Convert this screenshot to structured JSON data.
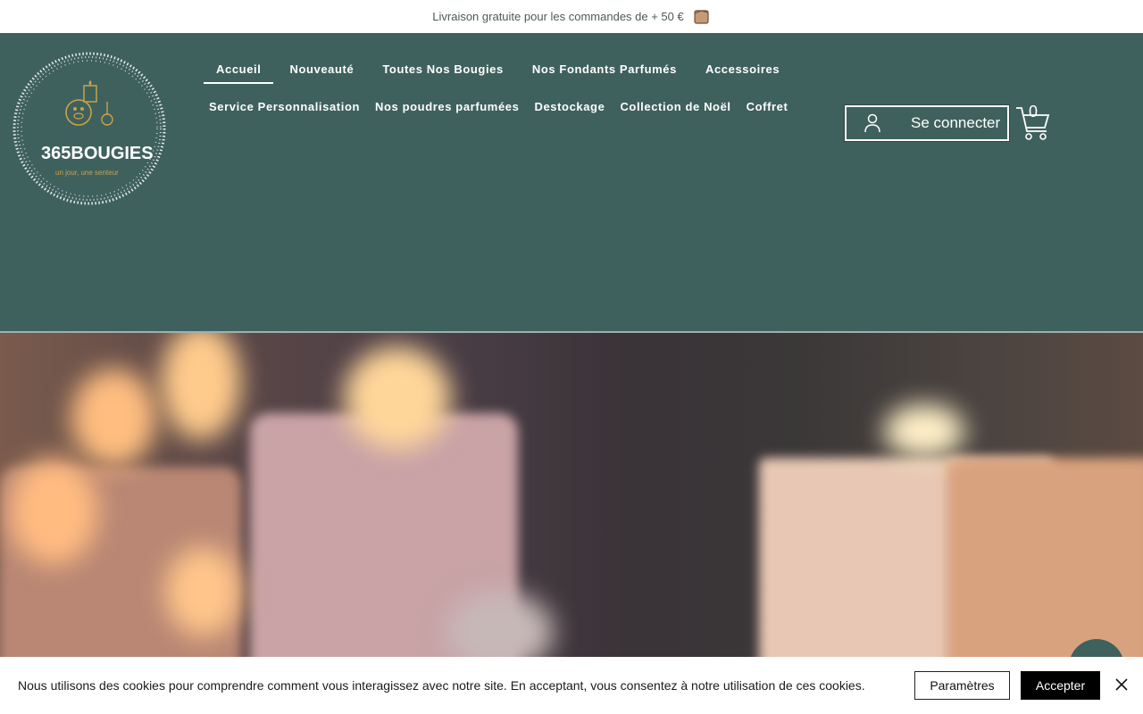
{
  "announcement": {
    "text": "Livraison gratuite pour les commandes de + 50 €",
    "icon": "package-box-icon"
  },
  "logo": {
    "brand": "365BOUGIES",
    "tagline": "un jour, une senteur"
  },
  "nav": {
    "row1": [
      {
        "label": "Accueil",
        "active": true
      },
      {
        "label": "Nouveauté"
      },
      {
        "label": "Toutes Nos Bougies"
      },
      {
        "label": "Nos Fondants Parfumés"
      },
      {
        "label": "Accessoires"
      }
    ],
    "row2": [
      {
        "label": "Service Personnalisation"
      },
      {
        "label": "Nos poudres parfumées"
      },
      {
        "label": "Destockage"
      },
      {
        "label": "Collection de Noël"
      },
      {
        "label": "Coffret"
      }
    ]
  },
  "account": {
    "login_label": "Se connecter",
    "icon": "user-icon"
  },
  "cart": {
    "count": "0",
    "icon": "cart-icon"
  },
  "cookie": {
    "message": "Nous utilisons des cookies pour comprendre comment vous interagissez avec notre site. En acceptant, vous consentez à notre utilisation de ces cookies.",
    "settings_label": "Paramètres",
    "accept_label": "Accepter"
  },
  "colors": {
    "header_bg": "#3f615d",
    "accent": "#ffffff"
  }
}
